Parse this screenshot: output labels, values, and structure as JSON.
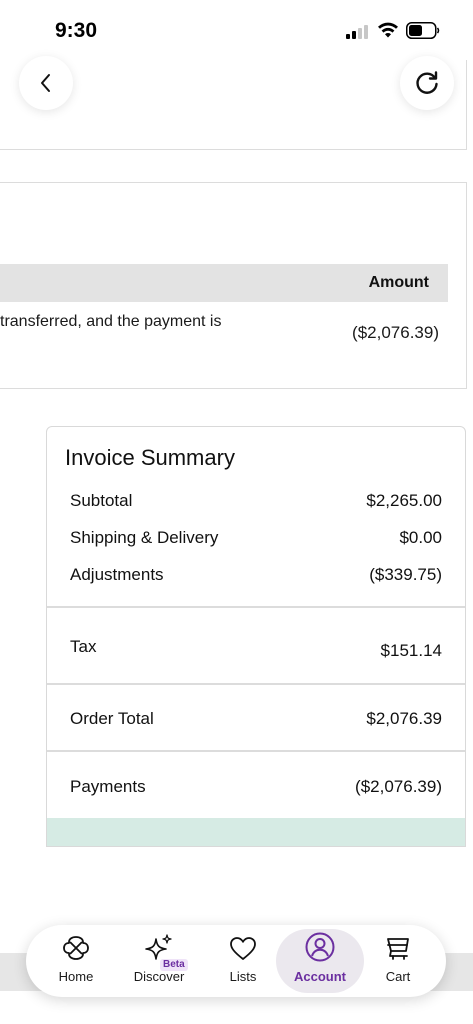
{
  "status_bar": {
    "time": "9:30"
  },
  "payment_table": {
    "header_amount": "Amount",
    "row_description": "transferred, and the payment is",
    "row_amount": "($2,076.39)"
  },
  "invoice_summary": {
    "title": "Invoice Summary",
    "subtotal_label": "Subtotal",
    "subtotal_value": "$2,265.00",
    "shipping_label": "Shipping & Delivery",
    "shipping_value": "$0.00",
    "adjustments_label": "Adjustments",
    "adjustments_value": "($339.75)",
    "tax_label": "Tax",
    "tax_value": "$151.14",
    "order_total_label": "Order Total",
    "order_total_value": "$2,076.39",
    "payments_label": "Payments",
    "payments_value": "($2,076.39)"
  },
  "bottom_nav": {
    "home": "Home",
    "discover": "Discover",
    "discover_badge": "Beta",
    "lists": "Lists",
    "account": "Account",
    "cart": "Cart",
    "active": "account"
  },
  "icons": {
    "back": "chevron-left-icon",
    "refresh": "refresh-icon",
    "home": "home-icon",
    "discover": "sparkle-icon",
    "lists": "heart-icon",
    "account": "user-circle-icon",
    "cart": "cart-icon"
  },
  "colors": {
    "accent": "#6b2fa0",
    "summary_footer": "#d6ebe4",
    "table_header": "#e3e3e3"
  }
}
